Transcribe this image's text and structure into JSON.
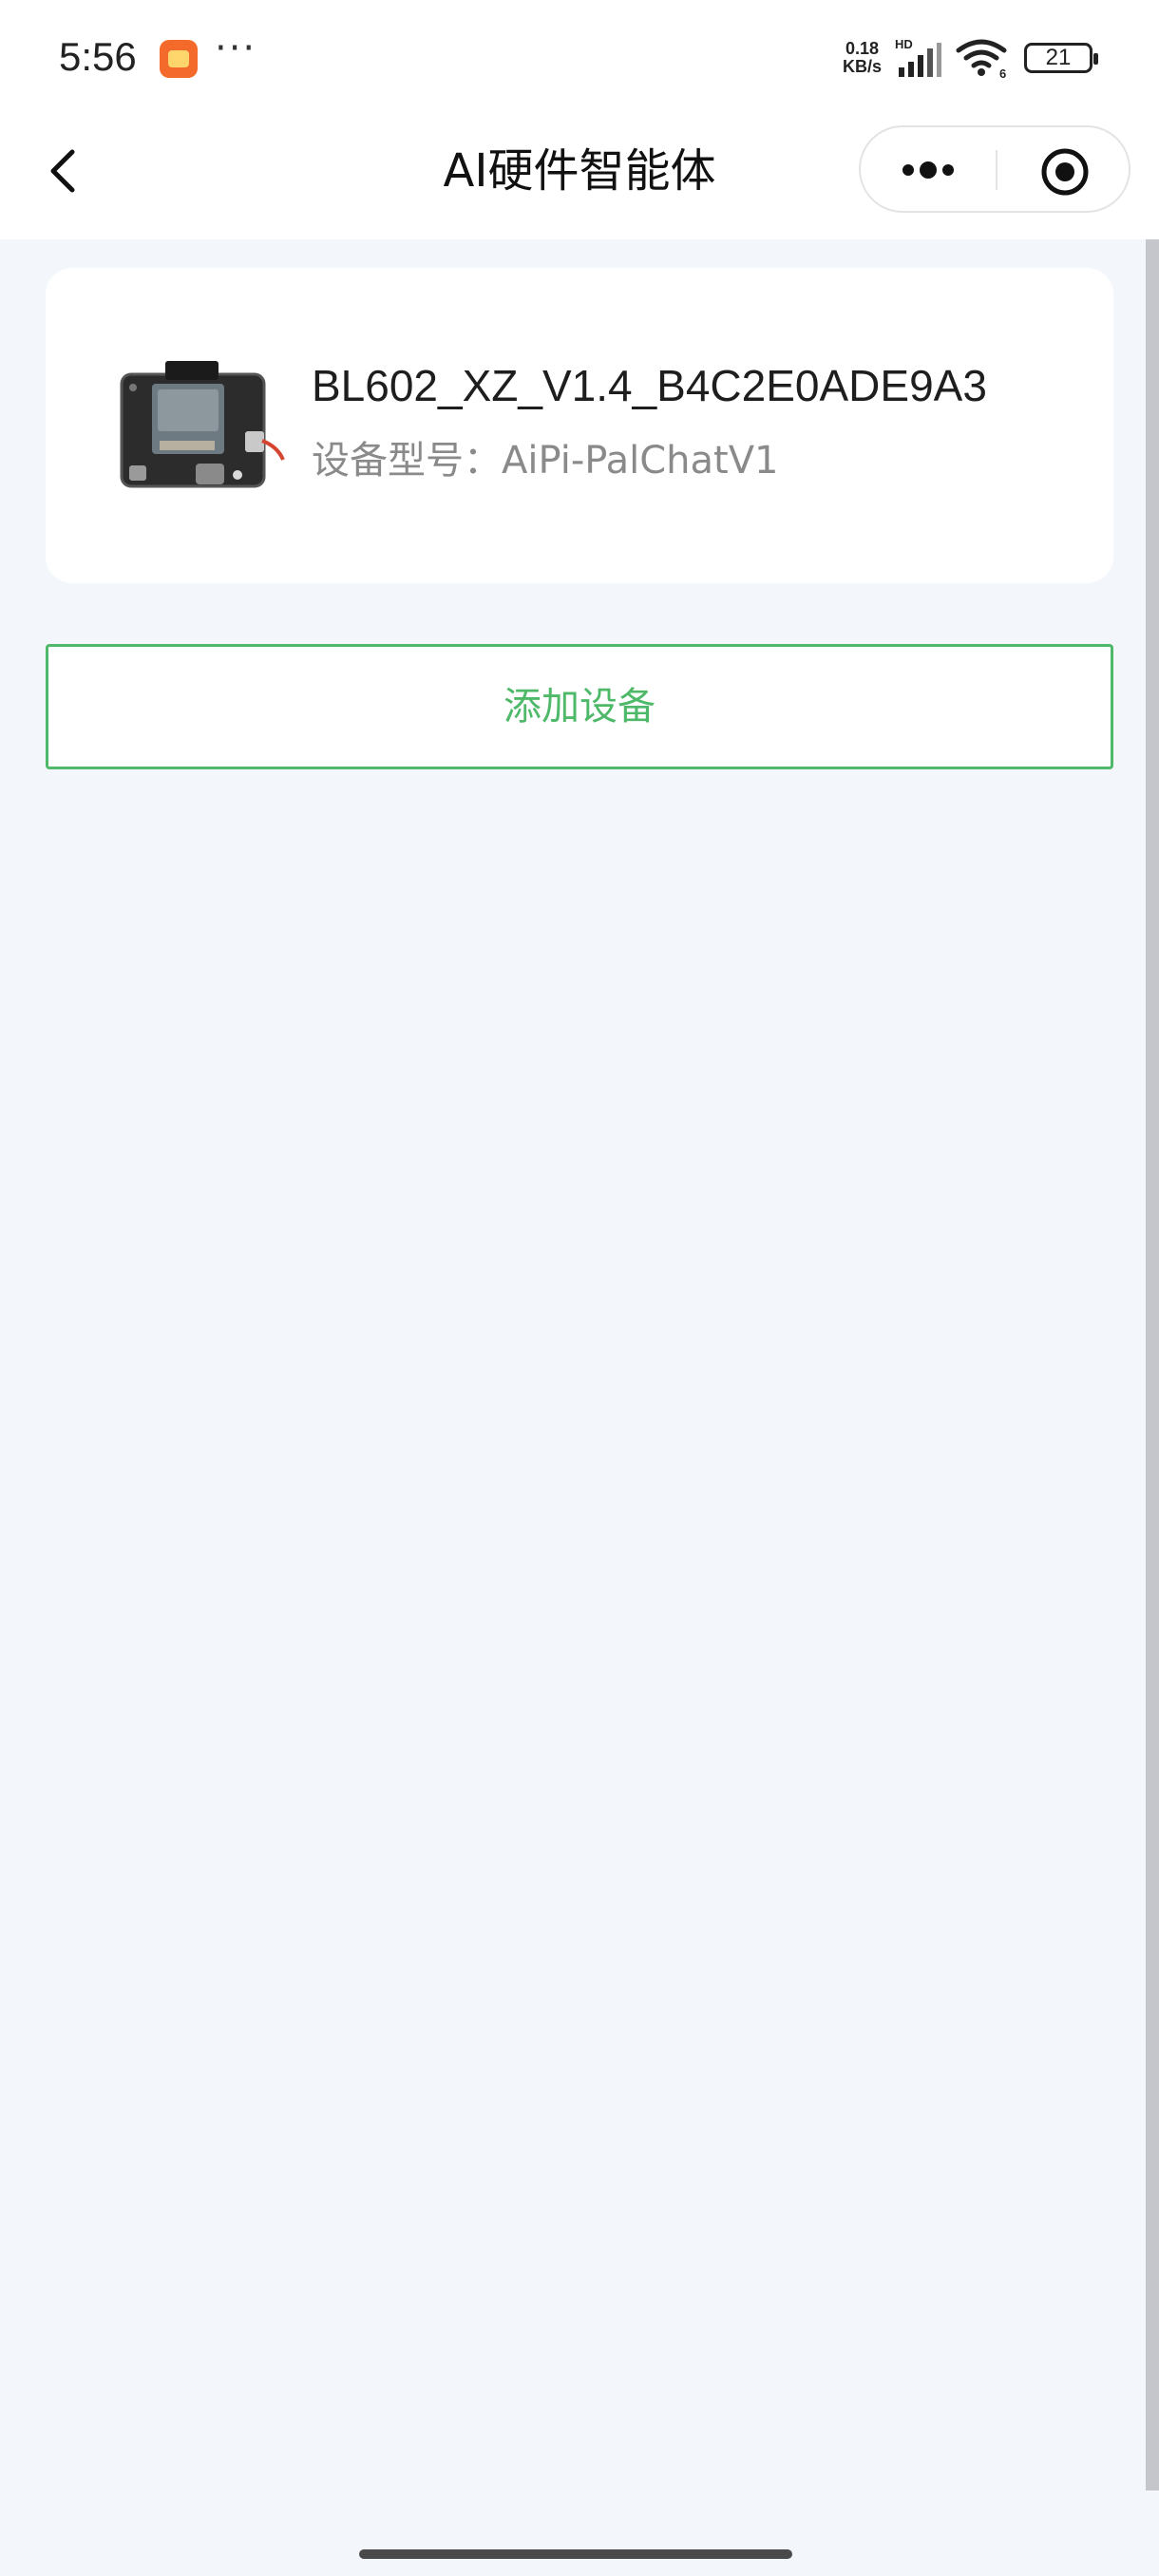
{
  "status_bar": {
    "time": "5:56",
    "more": "···",
    "net_speed_value": "0.18",
    "net_speed_unit": "KB/s",
    "signal_label": "HD",
    "wifi_label": "6",
    "battery": "21",
    "icons": [
      "app-notification-icon",
      "signal-icon",
      "wifi-icon",
      "battery-icon"
    ]
  },
  "nav": {
    "title": "AI硬件智能体",
    "icons": [
      "back-icon",
      "more-icon",
      "mini-program-close-icon"
    ]
  },
  "device": {
    "name": "BL602_XZ_V1.4_B4C2E0ADE9A3",
    "model": "设备型号：AiPi-PalChatV1"
  },
  "actions": {
    "add_device": "添加设备"
  },
  "colors": {
    "accent": "#4fb96a",
    "background": "#f3f6fb"
  }
}
